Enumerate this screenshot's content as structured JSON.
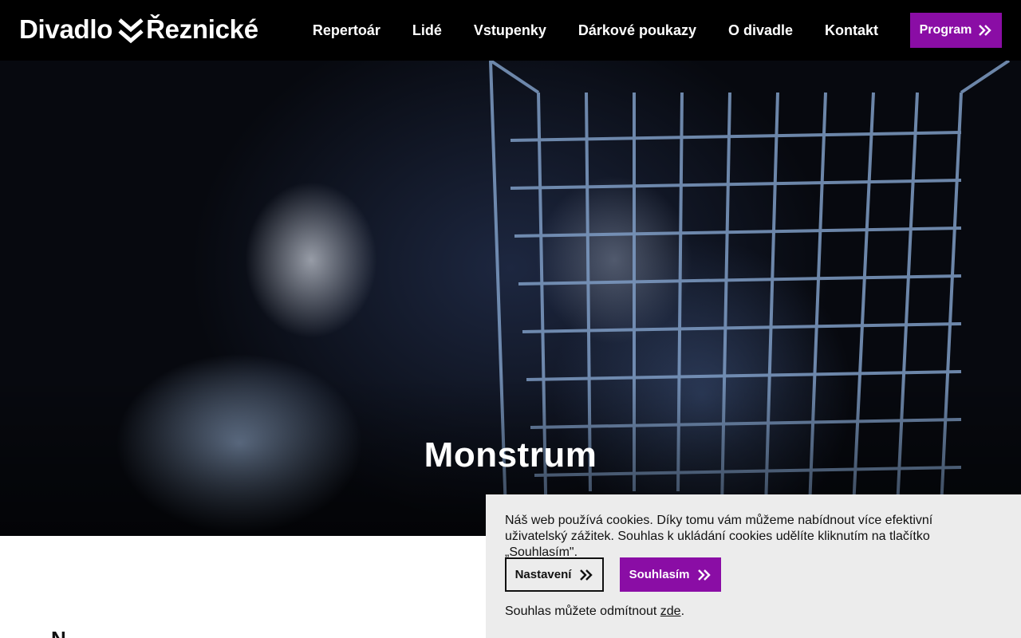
{
  "header": {
    "logo_left": "Divadlo",
    "logo_right": "Řeznické",
    "nav": [
      {
        "label": "Repertoár"
      },
      {
        "label": "Lidé"
      },
      {
        "label": "Vstupenky"
      },
      {
        "label": "Dárkové poukazy"
      },
      {
        "label": "O divadle"
      },
      {
        "label": "Kontakt"
      }
    ],
    "program_button": "Program"
  },
  "hero": {
    "title": "Monstrum"
  },
  "content": {
    "peek_heading": "N"
  },
  "cookie": {
    "text": "Náš web používá cookies. Díky tomu vám můžeme nabídnout více efektivní uživatelský zážitek. Souhlas k ukládání cookies udělíte kliknutím na tlačítko „Souhlasím\".",
    "settings_button": "Nastavení",
    "accept_button": "Souhlasím",
    "decline_prefix": "Souhlas můžete odmítnout ",
    "decline_link": "zde",
    "decline_suffix": "."
  },
  "colors": {
    "accent": "#8a0da5",
    "header_bg": "#000000",
    "cookie_bg": "#ececec"
  },
  "icons": {
    "logo_mark": "double-chevron-down-icon",
    "button_arrow": "double-chevron-right-icon"
  }
}
